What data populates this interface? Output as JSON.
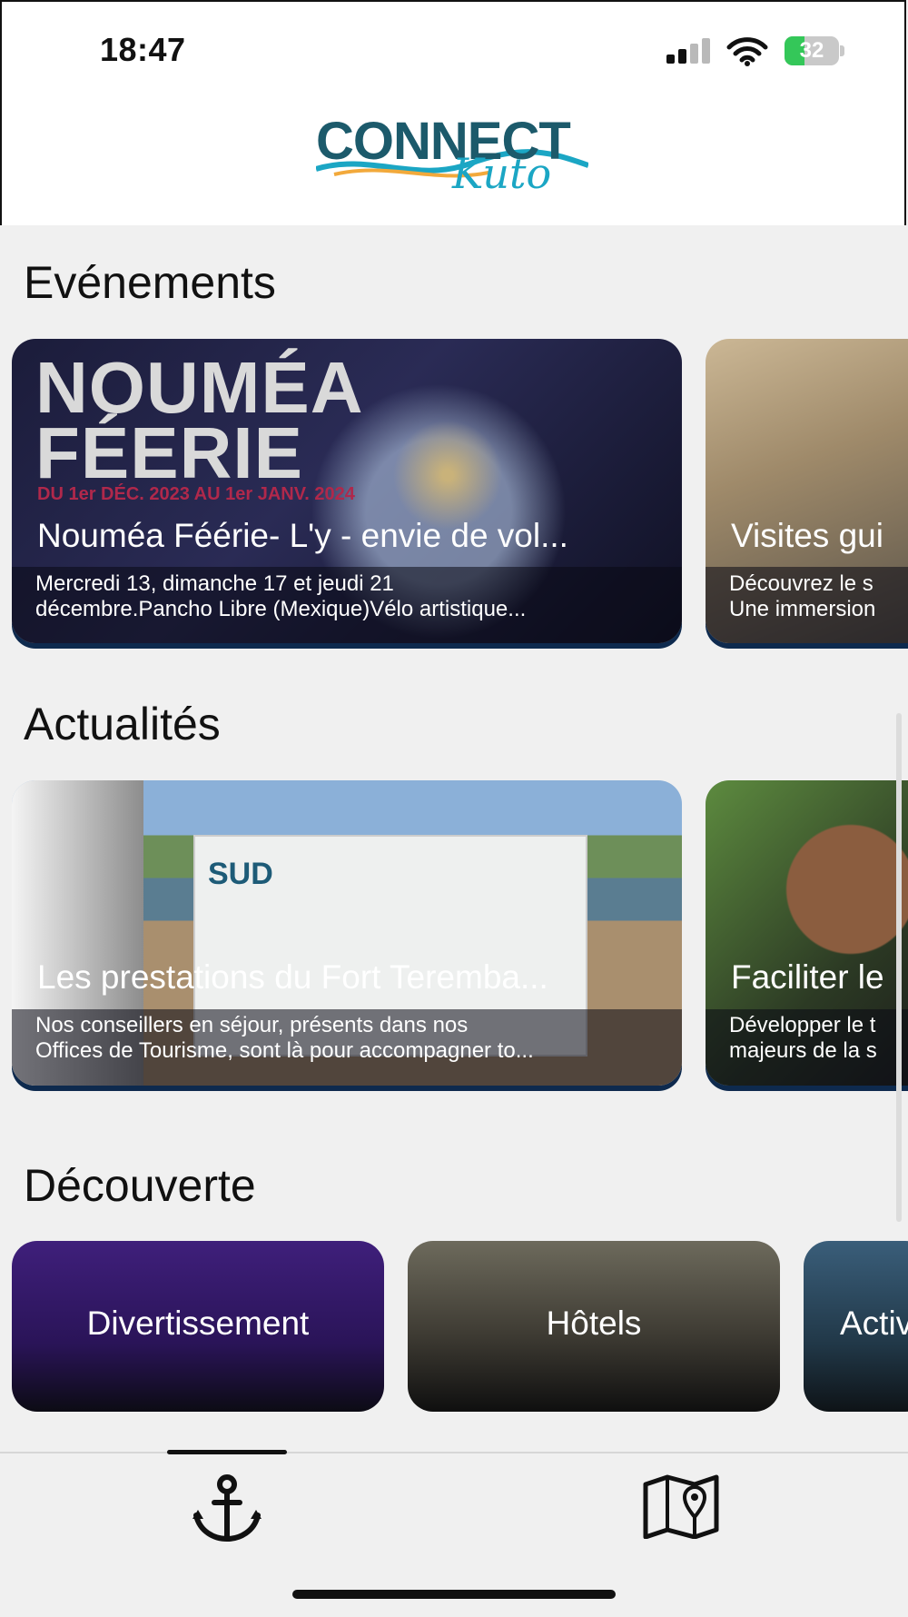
{
  "status_bar": {
    "time": "18:47",
    "battery": "32",
    "icons": [
      "signal-icon",
      "wifi-icon",
      "battery-charging-icon"
    ]
  },
  "brand": {
    "logo_main": "CONNECT",
    "logo_sub": "Kuto",
    "colors": {
      "primary": "#1c5a6b",
      "accent": "#1ba6c4",
      "wave_orange": "#f2a93b"
    }
  },
  "sections": {
    "events": {
      "title": "Evénements",
      "cards": [
        {
          "title": "Nouméa Féérie- L'y - envie de vol...",
          "description": "Mercredi 13, dimanche 17 et jeudi 21\ndécembre.Pancho Libre (Mexique)Vélo artistique...",
          "image_text": "NOUMÉA\nFÉERIE",
          "image_date": "DU 1er DÉC. 2023 AU 1er JANV. 2024"
        },
        {
          "title": "Visites gui",
          "description": "Découvrez le s\nUne immersion"
        }
      ]
    },
    "news": {
      "title": "Actualités",
      "cards": [
        {
          "title": "Les prestations du Fort Teremba...",
          "description": "Nos conseillers en séjour, présents dans nos\nOffices de Tourisme, sont là pour accompagner to...",
          "image_text": "SUD"
        },
        {
          "title": "Faciliter le",
          "description": "Développer le t\nmajeurs de la s"
        }
      ]
    },
    "discovery": {
      "title": "Découverte",
      "tiles": [
        {
          "label": "Divertissement"
        },
        {
          "label": "Hôtels"
        },
        {
          "label": "Activ"
        }
      ]
    }
  },
  "tab_bar": {
    "tabs": [
      {
        "icon": "anchor-icon",
        "selected": true
      },
      {
        "icon": "map-icon",
        "selected": false
      }
    ]
  }
}
